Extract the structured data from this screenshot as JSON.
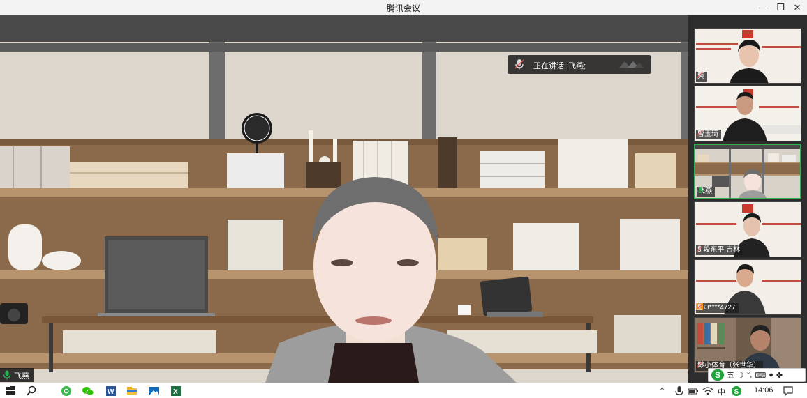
{
  "window": {
    "title": "腾讯会议",
    "min_icon": "minimize-icon",
    "max_icon": "restore-icon",
    "close_icon": "close-icon"
  },
  "main_video": {
    "speaking_banner_text": "正在讲话: 飞燕;",
    "speaker_name": "飞燕",
    "mic_icon": "microphone-icon"
  },
  "participants": [
    {
      "name": "黄",
      "muted": true
    },
    {
      "name": "曹玉琦",
      "muted": true
    },
    {
      "name": "飞燕",
      "muted": false,
      "active": true
    },
    {
      "name": "3 段东平 吉林",
      "muted": true
    },
    {
      "name": "133****4727",
      "muted": true,
      "host_icon": "person-icon"
    },
    {
      "name": "渺小体育（张世华）",
      "muted": true
    }
  ],
  "ime_toolbar": {
    "logo": "S",
    "mode": "五",
    "icons": [
      "moon-icon",
      "punctuation-icon",
      "keyboard-icon",
      "user-icon",
      "apps-icon"
    ]
  },
  "taskbar": {
    "apps": [
      "start-icon",
      "search-icon",
      "wechat-alt-icon",
      "wechat-icon",
      "word-icon",
      "file-explorer-icon",
      "photos-icon",
      "excel-icon"
    ],
    "tray": {
      "lang": "中",
      "time": "14:06"
    }
  },
  "colors": {
    "accent_green": "#2db157",
    "title_bg": "#f3f3f3"
  }
}
